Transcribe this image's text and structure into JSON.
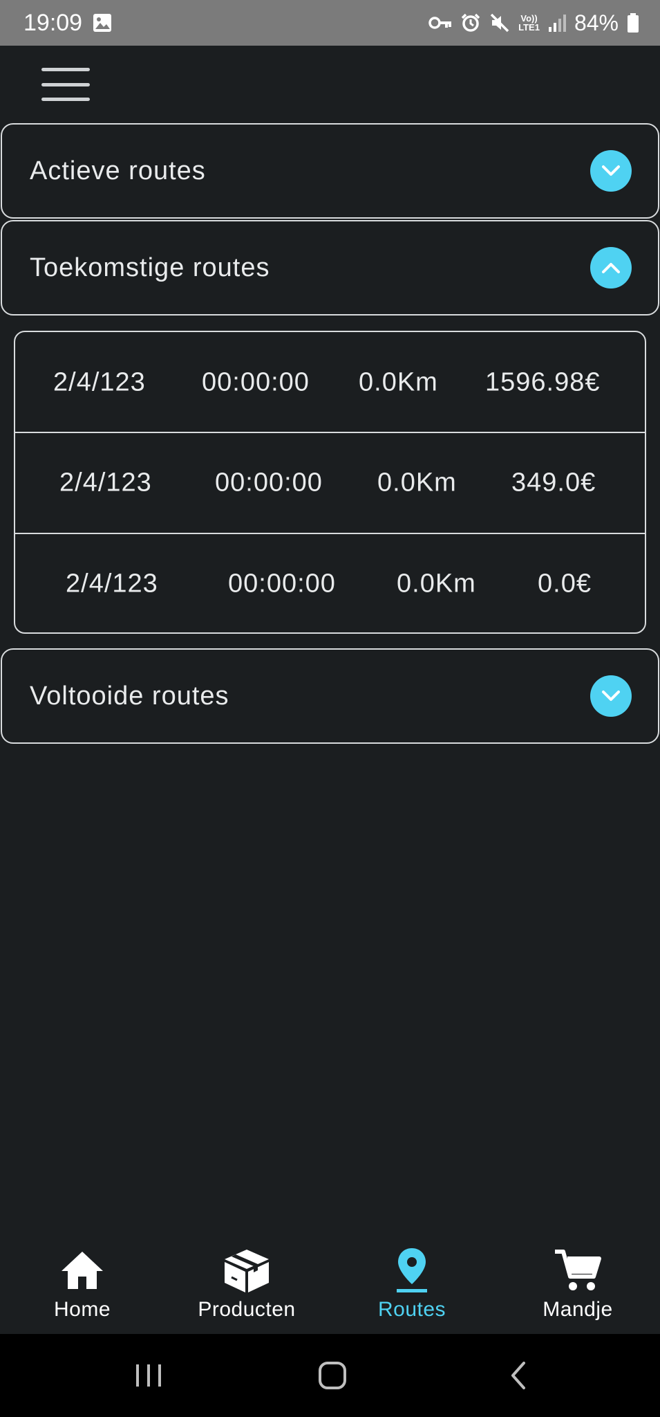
{
  "status_bar": {
    "time": "19:09",
    "battery": "84%",
    "network": "LTE1",
    "icons": [
      "image-icon",
      "vpn-key-icon",
      "alarm-icon",
      "mute-icon",
      "volte-icon",
      "signal-icon",
      "battery-icon"
    ]
  },
  "top_bar": {
    "menu_icon": "hamburger-menu-icon"
  },
  "sections": [
    {
      "title": "Actieve routes",
      "expanded": false,
      "chevron": "chevron-down-icon"
    },
    {
      "title": "Toekomstige routes",
      "expanded": true,
      "chevron": "chevron-up-icon"
    },
    {
      "title": "Voltooide routes",
      "expanded": false,
      "chevron": "chevron-down-icon"
    }
  ],
  "future_routes": [
    {
      "date": "2/4/123",
      "time": "00:00:00",
      "distance": "0.0Km",
      "price": "1596.98€"
    },
    {
      "date": "2/4/123",
      "time": "00:00:00",
      "distance": "0.0Km",
      "price": "349.0€"
    },
    {
      "date": "2/4/123",
      "time": "00:00:00",
      "distance": "0.0Km",
      "price": "0.0€"
    }
  ],
  "bottom_nav": [
    {
      "label": "Home",
      "icon": "home-icon",
      "active": false
    },
    {
      "label": "Producten",
      "icon": "box-icon",
      "active": false
    },
    {
      "label": "Routes",
      "icon": "location-pin-icon",
      "active": true
    },
    {
      "label": "Mandje",
      "icon": "cart-icon",
      "active": false
    }
  ],
  "colors": {
    "background": "#1b1e20",
    "accent": "#4fd2f2",
    "border": "#d9dcde",
    "status_bar": "#7b7b7b",
    "system_nav": "#000000"
  }
}
